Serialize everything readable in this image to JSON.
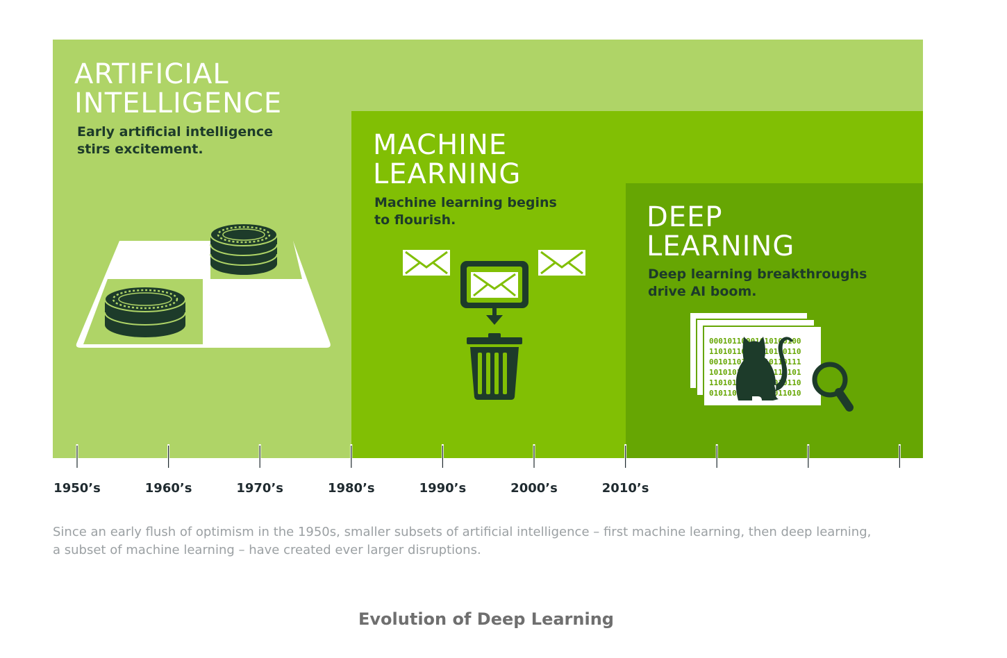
{
  "colors": {
    "ai_bg": "#afd467",
    "ml_bg": "#81bf04",
    "dl_bg": "#66a603",
    "ink": "#1d3b2a",
    "caption": "#9ba0a3"
  },
  "sections": {
    "ai": {
      "title_line1": "ARTIFICIAL",
      "title_line2": "INTELLIGENCE",
      "desc_line1": "Early artificial intelligence",
      "desc_line2": "stirs excitement.",
      "icon": "checkers-board-icon"
    },
    "ml": {
      "title_line1": "MACHINE",
      "title_line2": "LEARNING",
      "desc_line1": "Machine learning begins",
      "desc_line2": "to flourish.",
      "icon": "spam-filter-trash-icon"
    },
    "dl": {
      "title_line1": "DEEP",
      "title_line2": "LEARNING",
      "desc_line1": "Deep learning breakthroughs",
      "desc_line2": "drive AI boom.",
      "icon": "cat-recognition-magnifier-icon"
    }
  },
  "binary_rows": [
    "00010110001010100100",
    "11010110100110110110",
    "00101101011010110111",
    "10101011001010110101",
    "11010110101101010110",
    "01011010110101011010"
  ],
  "timeline": {
    "decades": [
      "1950’s",
      "1960’s",
      "1970’s",
      "1980’s",
      "1990’s",
      "2000’s",
      "2010’s"
    ],
    "tick_count": 10
  },
  "caption": "Since an early flush of optimism in the 1950s, smaller subsets of artificial intelligence – first machine learning, then deep learning, a subset of machine learning – have created ever larger disruptions.",
  "footer_title": "Evolution of Deep Learning"
}
